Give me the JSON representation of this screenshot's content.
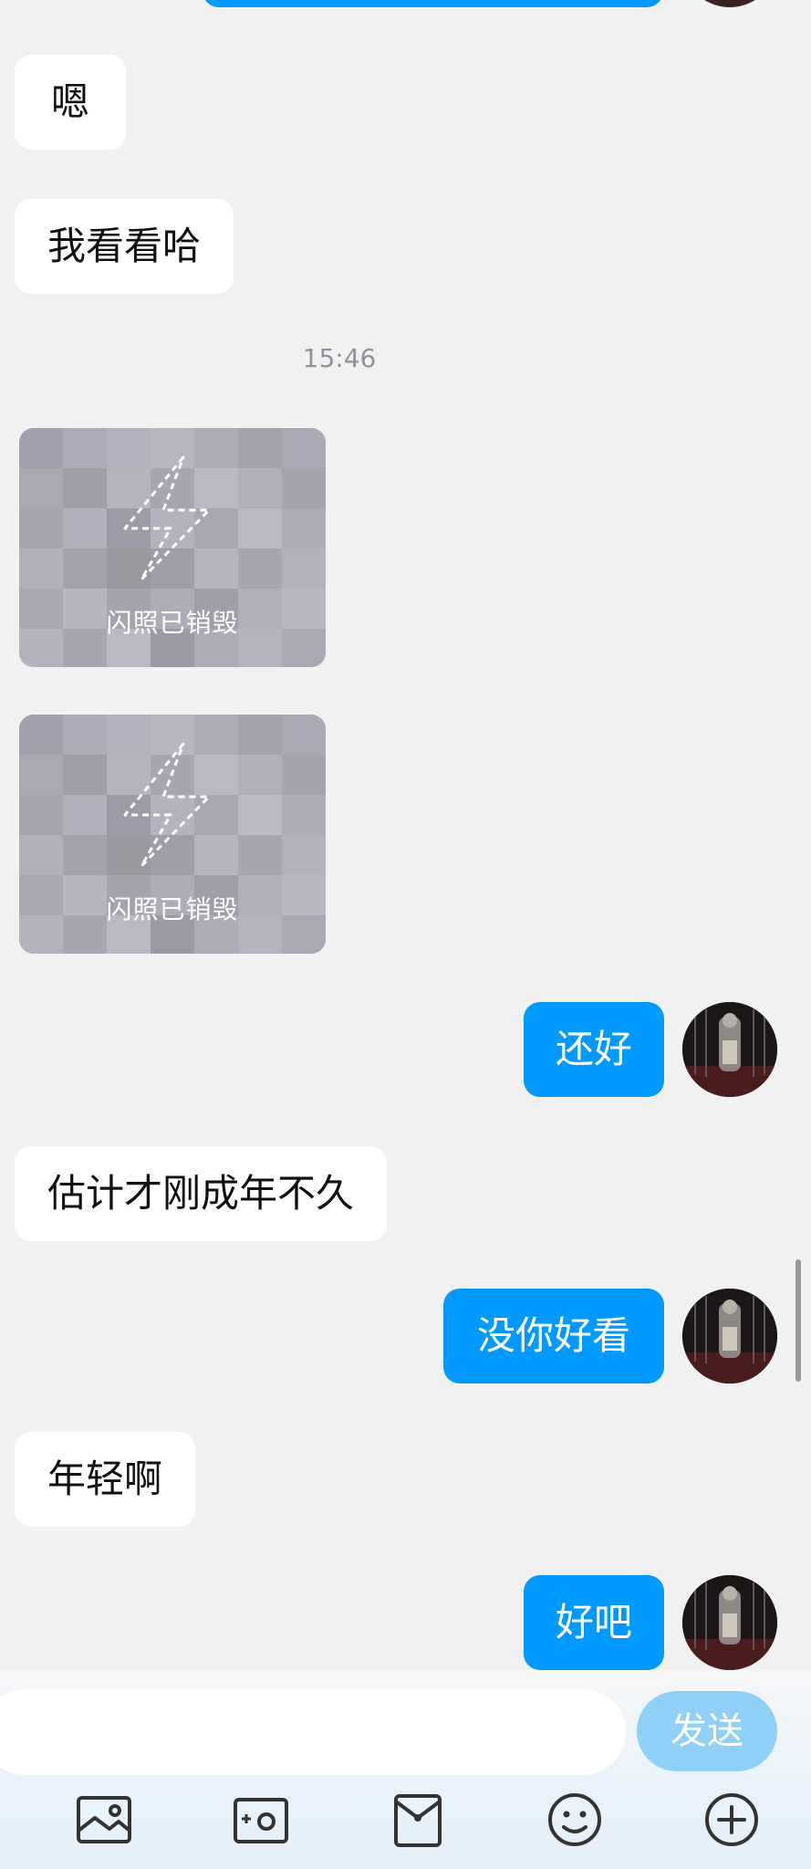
{
  "messages": {
    "m1": "嗯",
    "m2": "我看看哈",
    "timestamp": "15:46",
    "flash1": "闪照已销毁",
    "flash2": "闪照已销毁",
    "m3": "还好",
    "m4": "估计才刚成年不久",
    "m5": "没你好看",
    "m6": "年轻啊",
    "m7": "好吧"
  },
  "composer": {
    "input_value": "",
    "send_label": "发送"
  },
  "toolbar": {
    "icons": [
      "image-icon",
      "camera-icon",
      "red-packet-icon",
      "emoji-icon",
      "plus-icon"
    ]
  },
  "colors": {
    "outgoing_bubble": "#0099ff",
    "send_button": "#8fd0f7",
    "background": "#f1f1f1"
  }
}
